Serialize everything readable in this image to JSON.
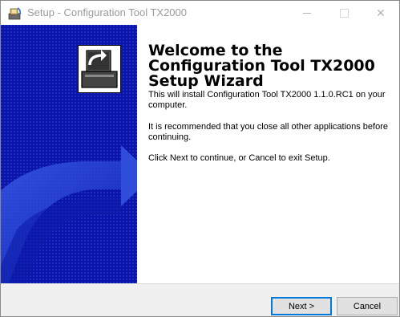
{
  "window": {
    "title": "Setup - Configuration Tool TX2000",
    "close_glyph": "✕"
  },
  "content": {
    "heading": "Welcome to the Configuration Tool TX2000 Setup Wizard",
    "install_text": "This will install Configuration Tool TX2000 1.1.0.RC1 on your computer.",
    "recommend_text": "It is recommended that you close all other applications before continuing.",
    "instructions_text": "Click Next to continue, or Cancel to exit Setup."
  },
  "buttons": {
    "next_label": "Next >",
    "cancel_label": "Cancel"
  },
  "colors": {
    "banner": "#0a14a6",
    "accent": "#0078d7"
  }
}
